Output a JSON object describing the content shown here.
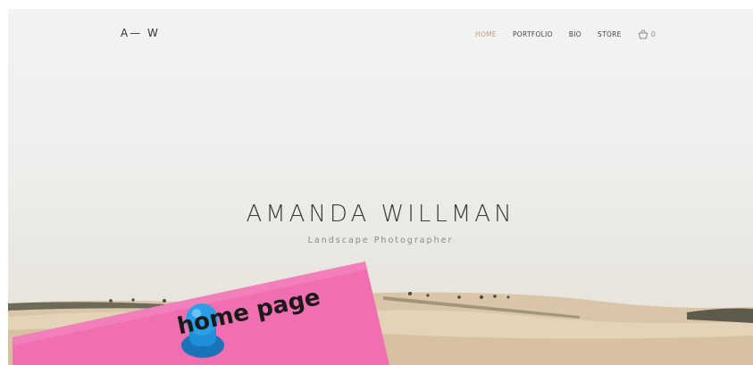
{
  "site": {
    "logo": "A— W",
    "nav": [
      {
        "label": "HOME",
        "active": true
      },
      {
        "label": "PORTFOLIO",
        "active": false
      },
      {
        "label": "BIO",
        "active": false
      },
      {
        "label": "STORE",
        "active": false
      }
    ],
    "cart_count": "0"
  },
  "hero": {
    "name": "AMANDA WILLMAN",
    "tagline": "Landscape Photographer"
  },
  "sticky_note": {
    "text": "home page",
    "color": "#f06fb0",
    "pin_color": "#1e8fd8"
  },
  "colors": {
    "accent": "#c79a86",
    "sky": "#efefed",
    "hills": "#d8c2a3"
  }
}
